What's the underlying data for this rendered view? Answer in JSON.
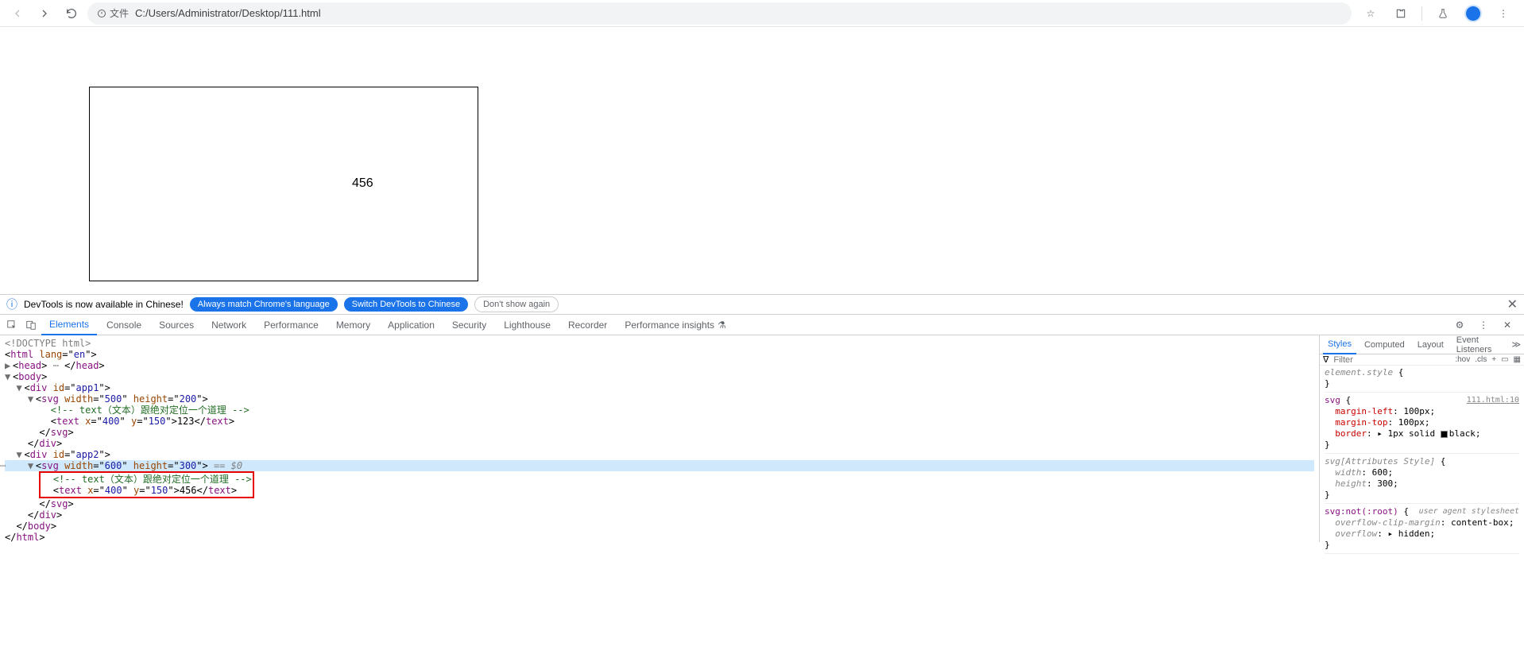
{
  "browser": {
    "file_chip": "文件",
    "url": "C:/Users/Administrator/Desktop/111.html"
  },
  "page": {
    "svg_text": "456"
  },
  "infobar": {
    "msg": "DevTools is now available in Chinese!",
    "chip1": "Always match Chrome's language",
    "chip2": "Switch DevTools to Chinese",
    "chip3": "Don't show again"
  },
  "tabs": {
    "elements": "Elements",
    "console": "Console",
    "sources": "Sources",
    "network": "Network",
    "performance": "Performance",
    "memory": "Memory",
    "application": "Application",
    "security": "Security",
    "lighthouse": "Lighthouse",
    "recorder": "Recorder",
    "perf_insights": "Performance insights"
  },
  "tree": {
    "doctype": "<!DOCTYPE html>",
    "html_open": "html",
    "html_lang": "en",
    "head": "head",
    "body": "body",
    "div1_id": "app1",
    "svg1_w": "500",
    "svg1_h": "200",
    "comment": " text（文本）跟绝对定位一个道理 ",
    "text1_x": "400",
    "text1_y": "150",
    "text1_val": "123",
    "div2_id": "app2",
    "svg2_w": "600",
    "svg2_h": "300",
    "eq0": " == $0",
    "text2_x": "400",
    "text2_y": "150",
    "text2_val": "456"
  },
  "styles": {
    "tabs": {
      "styles": "Styles",
      "computed": "Computed",
      "layout": "Layout",
      "events": "Event Listeners"
    },
    "filter_ph": "Filter",
    "hov": ":hov",
    "cls": ".cls",
    "elstyle": "element.style",
    "r1_sel": "svg",
    "r1_link": "111.html:10",
    "r1_p1": "margin-left",
    "r1_v1": "100px",
    "r1_p2": "margin-top",
    "r1_v2": "100px",
    "r1_p3": "border",
    "r1_v3": "1px solid ",
    "r1_v3b": "black",
    "r2_sel": "svg[Attributes Style]",
    "r2_p1": "width",
    "r2_v1": "600",
    "r2_p2": "height",
    "r2_v2": "300",
    "r3_sel": "svg:not(:root)",
    "r3_ua": "user agent stylesheet",
    "r3_p1": "overflow-clip-margin",
    "r3_v1": "content-box",
    "r3_p2": "overflow",
    "r3_v2": "hidden"
  }
}
